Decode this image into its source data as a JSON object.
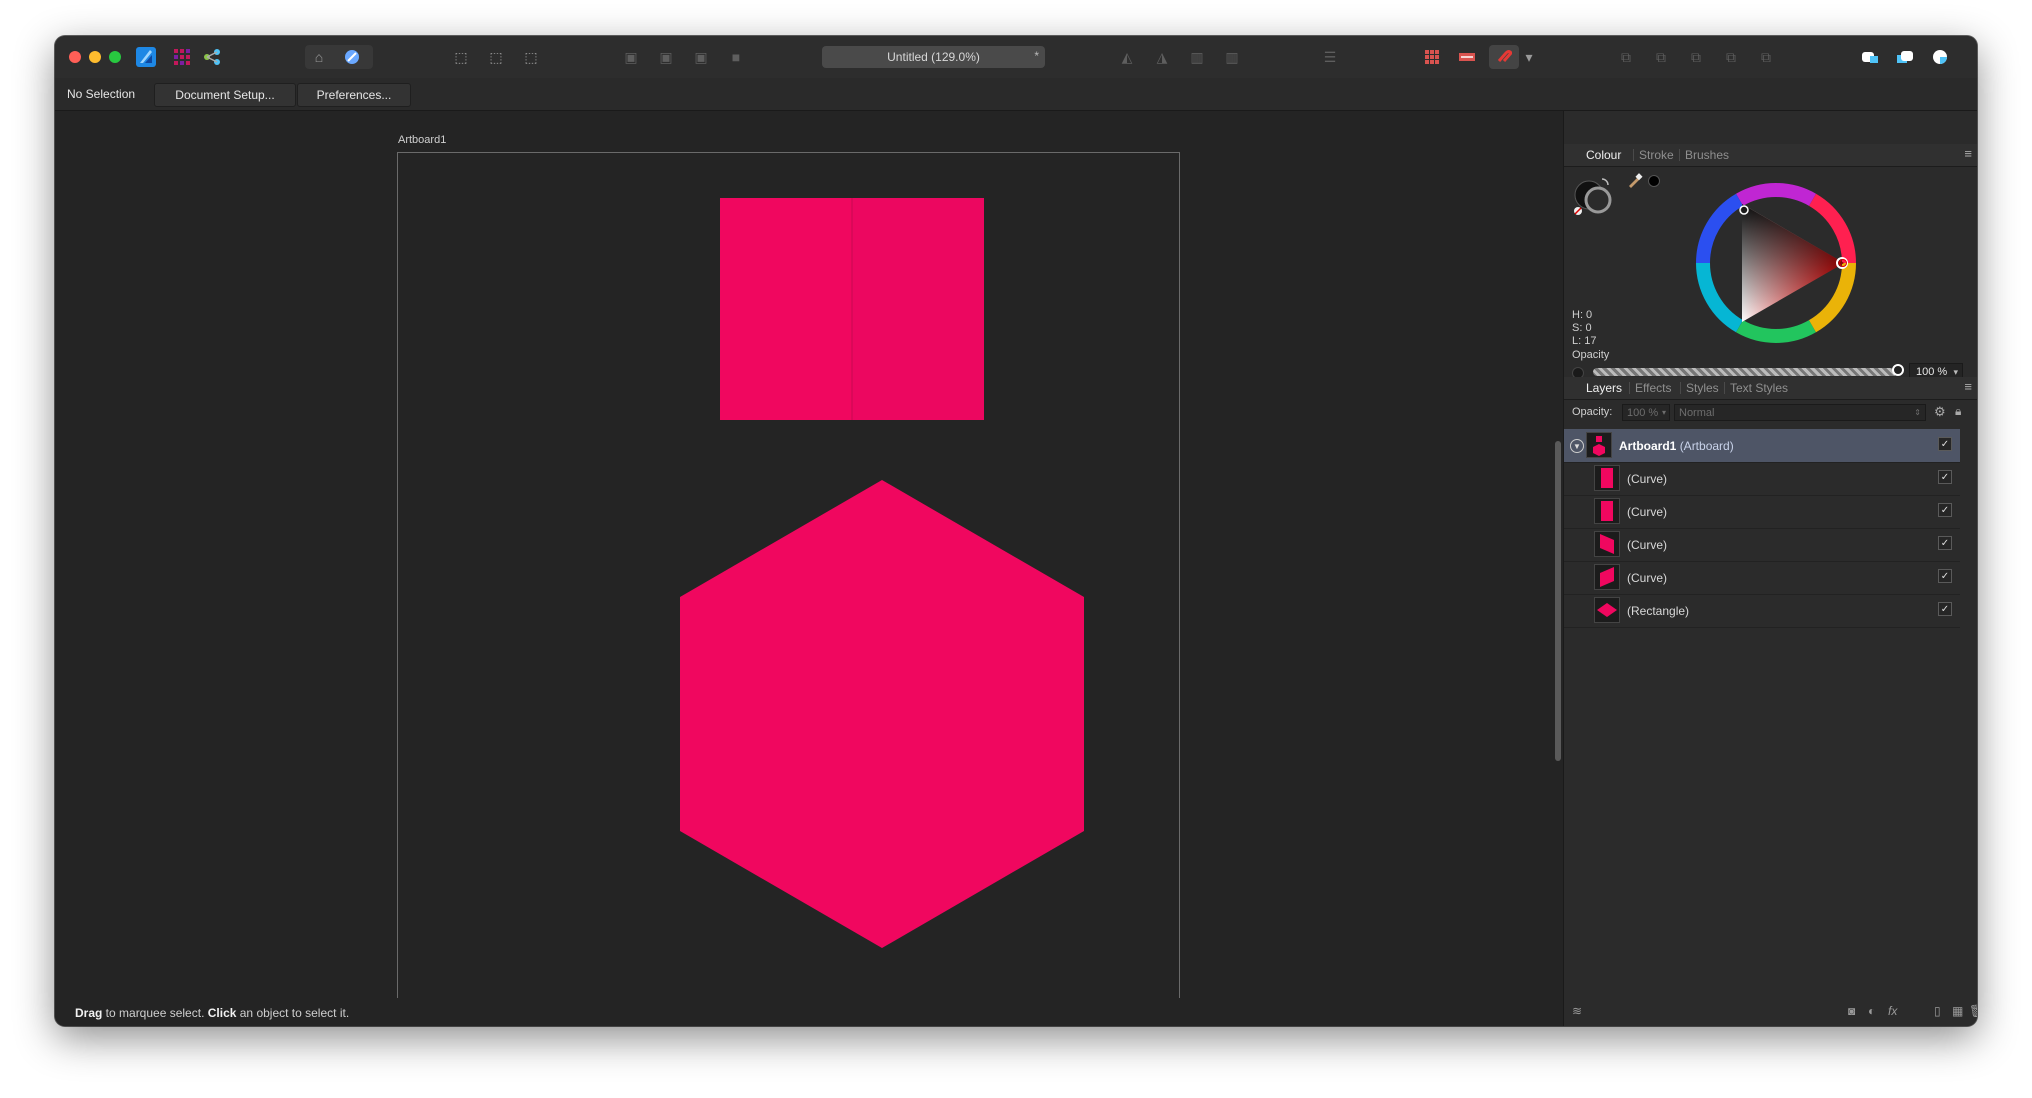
{
  "document": {
    "title": "Untitled (129.0%)",
    "close_glyph": "*"
  },
  "context_toolbar": {
    "selection_label": "No Selection",
    "buttons": [
      "Document Setup...",
      "Preferences..."
    ]
  },
  "canvas": {
    "artboard_label": "Artboard1",
    "shape_color": "#f0075f"
  },
  "status_bar": {
    "part1_bold": "Drag",
    "part1": " to marquee select. ",
    "part2_bold": "Click",
    "part2": " an object to select it."
  },
  "colour_panel": {
    "tabs": [
      "Colour",
      "Stroke",
      "Brushes"
    ],
    "active_tab": "Colour",
    "hsl": {
      "h": "H: 0",
      "s": "S: 0",
      "l": "L: 17"
    },
    "opacity_label": "Opacity",
    "opacity_value": "100 %"
  },
  "layers_panel": {
    "tabs": [
      "Layers",
      "Effects",
      "Styles",
      "Text Styles"
    ],
    "active_tab": "Layers",
    "opacity_label": "Opacity:",
    "opacity_value": "100 %",
    "blend_mode": "Normal",
    "artboard": {
      "name": "Artboard1",
      "type": "(Artboard)"
    },
    "layers": [
      {
        "name": "(Curve)",
        "visible": true
      },
      {
        "name": "(Curve)",
        "visible": true
      },
      {
        "name": "(Curve)",
        "visible": true
      },
      {
        "name": "(Curve)",
        "visible": true
      },
      {
        "name": "(Rectangle)",
        "visible": true
      }
    ],
    "check_glyph": "✓"
  }
}
